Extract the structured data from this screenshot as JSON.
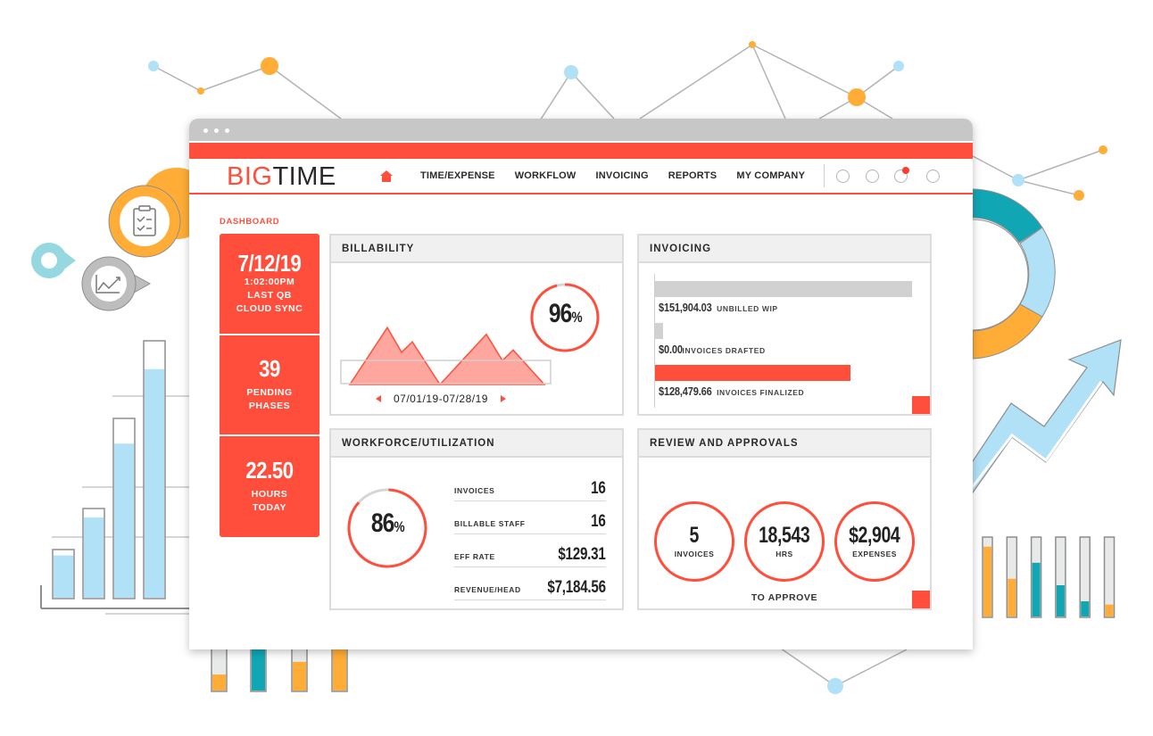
{
  "app": {
    "logo_part1": "BIG",
    "logo_part2": "TIME",
    "brand_color": "#ff4f3c"
  },
  "nav": {
    "home_icon": "home-icon",
    "items": [
      {
        "label": "TIME/EXPENSE"
      },
      {
        "label": "WORKFLOW"
      },
      {
        "label": "INVOICING"
      },
      {
        "label": "REPORTS"
      },
      {
        "label": "MY COMPANY"
      }
    ],
    "status_circles": [
      {
        "name": "status-circle-1",
        "notification": false
      },
      {
        "name": "status-circle-2",
        "notification": false
      },
      {
        "name": "status-circle-3",
        "notification": true
      },
      {
        "name": "status-circle-4",
        "notification": false
      }
    ]
  },
  "breadcrumb": "DASHBOARD",
  "tiles": [
    {
      "value": "7/12/19",
      "lines": [
        "1:02:00PM",
        "LAST QB",
        "CLOUD SYNC"
      ]
    },
    {
      "value": "39",
      "lines": [
        "PENDING",
        "PHASES"
      ]
    },
    {
      "value": "22.50",
      "lines": [
        "HOURS",
        "TODAY"
      ]
    }
  ],
  "billability": {
    "title": "BILLABILITY",
    "percent_value": "96",
    "percent_sign": "%",
    "percent_fraction": 0.96,
    "date_range": "07/01/19-07/28/19",
    "area_series": [
      0,
      0.76,
      0.43,
      0.57,
      0,
      0.67,
      0.32,
      0.46,
      0
    ]
  },
  "invoicing": {
    "title": "INVOICING",
    "rows": [
      {
        "amount": "$151,904.03",
        "caption": "UNBILLED WIP",
        "fraction": 1.0,
        "color": "#d1d1d1"
      },
      {
        "amount": "$0.00",
        "caption": "INVOICES DRAFTED",
        "fraction": 0.03,
        "color": "#d1d1d1"
      },
      {
        "amount": "$128,479.66",
        "caption": "INVOICES FINALIZED",
        "fraction": 0.76,
        "color": "#ff4f3c"
      }
    ]
  },
  "workforce": {
    "title": "WORKFORCE/UTILIZATION",
    "percent_value": "86",
    "percent_sign": "%",
    "percent_fraction": 0.86,
    "stats": [
      {
        "label": "INVOICES",
        "value": "16"
      },
      {
        "label": "BILLABLE STAFF",
        "value": "16"
      },
      {
        "label": "EFF RATE",
        "value": "$129.31"
      },
      {
        "label": "REVENUE/HEAD",
        "value": "$7,184.56"
      }
    ]
  },
  "approvals": {
    "title": "REVIEW AND APPROVALS",
    "items": [
      {
        "value": "5",
        "caption": "INVOICES"
      },
      {
        "value": "18,543",
        "caption": "HRS"
      },
      {
        "value": "$2,904",
        "caption": "EXPENSES"
      }
    ],
    "footer": "TO APPROVE"
  },
  "decor": {
    "colors": {
      "orange": "#ffad37",
      "light_blue": "#b1e1f6",
      "teal": "#11a6b4",
      "gray": "#b8b8b8"
    },
    "left_bars_fill": [
      0.88,
      0.9,
      0.86,
      0.89
    ],
    "bottom_bars_fill": [
      0.18,
      0.72,
      0.46,
      0.88
    ],
    "right_bars_fill": [
      0.88,
      0.48,
      0.68,
      0.4,
      0.2,
      0.16
    ],
    "donut_segments": [
      "teal",
      "light_blue",
      "orange"
    ]
  }
}
